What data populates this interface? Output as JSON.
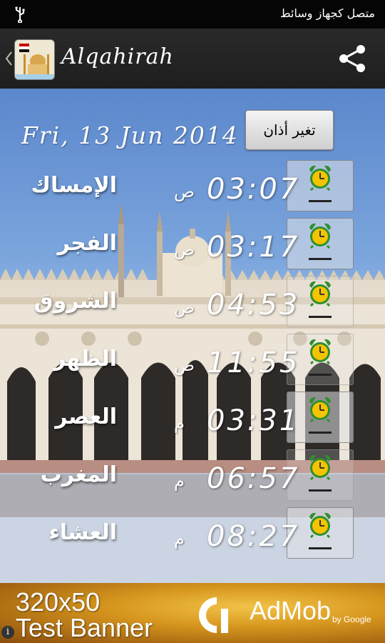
{
  "status_bar": {
    "text": "متصل كجهاز وسائط"
  },
  "action_bar": {
    "title": "Alqahirah"
  },
  "main": {
    "date": "Fri, 13 Jun 2014",
    "adhan_button_label": "تغير أذان",
    "prayers": [
      {
        "name": "الإمساك",
        "time": "03:07",
        "ampm": "ص",
        "alarm_enabled": true
      },
      {
        "name": "الفجر",
        "time": "03:17",
        "ampm": "ص",
        "alarm_enabled": true
      },
      {
        "name": "الشروق",
        "time": "04:53",
        "ampm": "ص",
        "alarm_enabled": false
      },
      {
        "name": "الظهر",
        "time": "11:55",
        "ampm": "ص",
        "alarm_enabled": false
      },
      {
        "name": "العصر",
        "time": "03:31",
        "ampm": "م",
        "alarm_enabled": true
      },
      {
        "name": "المغرب",
        "time": "06:57",
        "ampm": "م",
        "alarm_enabled": false
      },
      {
        "name": "العشاء",
        "time": "08:27",
        "ampm": "م",
        "alarm_enabled": true
      }
    ]
  },
  "ad": {
    "line1": "320x50",
    "line2": "Test Banner",
    "brand": "AdMob",
    "by": "by Google"
  },
  "colors": {
    "alarm_yellow": "#f5c400",
    "alarm_green": "#2f8f2f",
    "action_bar": "#232323"
  },
  "icons": [
    "usb-icon",
    "chevron-left-icon",
    "mosque-app-icon",
    "share-icon",
    "alarm-clock-icon",
    "admob-logo",
    "info-icon"
  ]
}
